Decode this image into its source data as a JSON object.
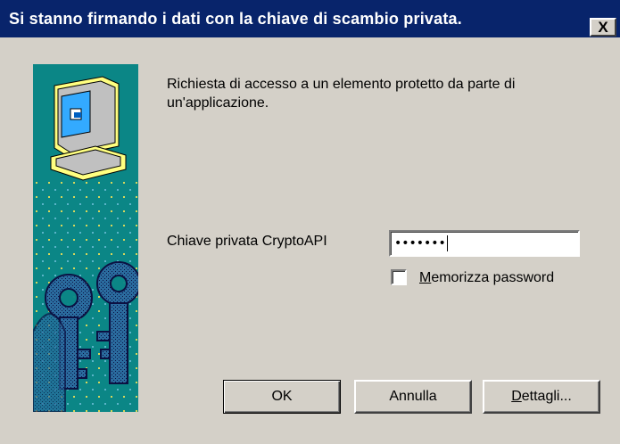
{
  "window": {
    "title": "Si stanno firmando i dati con la chiave di scambio privata.",
    "close_label": "X"
  },
  "message": "Richiesta di accesso a un elemento protetto da parte di un'applicazione.",
  "password": {
    "label": "Chiave privata CryptoAPI",
    "masked_value": "•••••••"
  },
  "remember": {
    "label_first": "M",
    "label_rest": "emorizza password",
    "checked": false
  },
  "buttons": {
    "ok": "OK",
    "cancel": "Annulla",
    "details_first": "D",
    "details_rest": "ettagli..."
  },
  "colors": {
    "title_bg": "#08246b",
    "dialog_bg": "#d4d0c8",
    "art_bg": "#0b8686"
  },
  "icons": {
    "art": "computer-with-keys-icon",
    "close": "close-icon"
  }
}
